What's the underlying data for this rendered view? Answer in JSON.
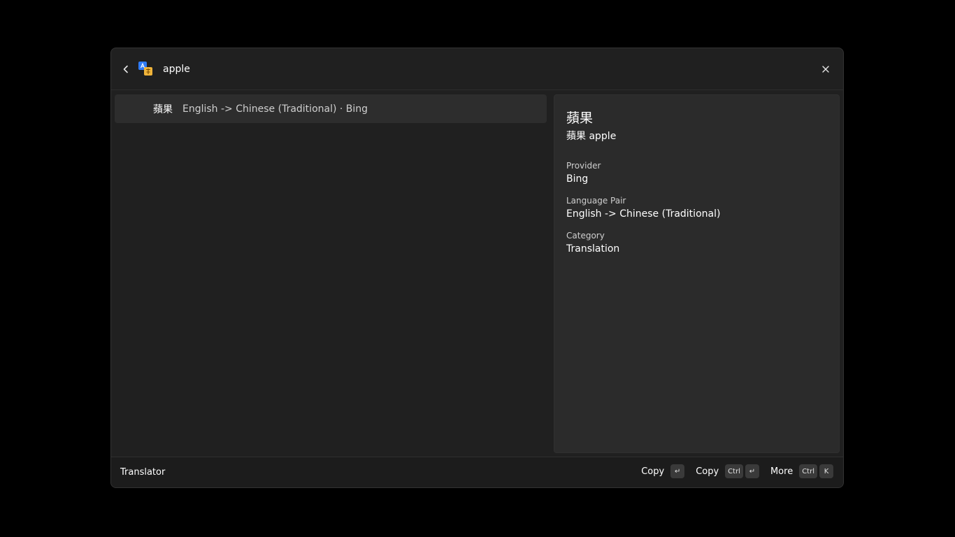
{
  "search": {
    "value": "apple"
  },
  "results": [
    {
      "title": "蘋果",
      "subtitle": "English -> Chinese (Traditional) · Bing"
    }
  ],
  "details": {
    "title": "蘋果",
    "subtitle": "蘋果 apple",
    "fields": [
      {
        "label": "Provider",
        "value": "Bing"
      },
      {
        "label": "Language Pair",
        "value": "English -> Chinese (Traditional)"
      },
      {
        "label": "Category",
        "value": "Translation"
      }
    ]
  },
  "footer": {
    "title": "Translator",
    "actions": [
      {
        "label": "Copy",
        "keys": [
          "↵"
        ]
      },
      {
        "label": "Copy",
        "keys": [
          "Ctrl",
          "↵"
        ]
      },
      {
        "label": "More",
        "keys": [
          "Ctrl",
          "K"
        ]
      }
    ]
  },
  "icons": {
    "back": "chevron-left-icon",
    "app": "translator-icon",
    "close": "close-icon"
  },
  "colors": {
    "background": "#000000",
    "window": "#202020",
    "selected_item": "#2d2d2d",
    "detail_panel": "#2b2b2b",
    "key_badge": "#3a3a3a",
    "app_icon_blue": "#2f7bf6",
    "app_icon_yellow": "#f0b43a"
  }
}
